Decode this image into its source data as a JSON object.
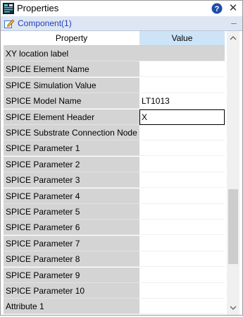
{
  "window": {
    "title": "Properties"
  },
  "component": {
    "label": "Component(1)"
  },
  "grid": {
    "headers": {
      "property": "Property",
      "value": "Value"
    },
    "rows": [
      {
        "property": "XY location label",
        "value": "",
        "state": "gray"
      },
      {
        "property": "SPICE Element Name",
        "value": ""
      },
      {
        "property": "SPICE Simulation Value",
        "value": ""
      },
      {
        "property": "SPICE Model Name",
        "value": "LT1013"
      },
      {
        "property": "SPICE Element Header",
        "value": "X",
        "state": "editing"
      },
      {
        "property": "SPICE Substrate Connection Node",
        "value": ""
      },
      {
        "property": "SPICE Parameter 1",
        "value": ""
      },
      {
        "property": "SPICE Parameter 2",
        "value": ""
      },
      {
        "property": "SPICE Parameter 3",
        "value": ""
      },
      {
        "property": "SPICE Parameter 4",
        "value": ""
      },
      {
        "property": "SPICE Parameter 5",
        "value": ""
      },
      {
        "property": "SPICE Parameter 6",
        "value": ""
      },
      {
        "property": "SPICE Parameter 7",
        "value": ""
      },
      {
        "property": "SPICE Parameter 8",
        "value": ""
      },
      {
        "property": "SPICE Parameter 9",
        "value": ""
      },
      {
        "property": "SPICE Parameter 10",
        "value": ""
      },
      {
        "property": "Attribute 1",
        "value": ""
      }
    ]
  },
  "icons": {
    "app": "properties-app-icon",
    "help": "help-icon",
    "close": "close-icon",
    "component": "edit-component-icon",
    "collapse": "collapse-icon",
    "scroll_up": "chevron-up-icon",
    "scroll_down": "chevron-down-icon"
  },
  "colors": {
    "header_value_bg": "#cde4f7",
    "component_text": "#1f3fbf",
    "property_cell_bg": "#d4d4d4"
  }
}
